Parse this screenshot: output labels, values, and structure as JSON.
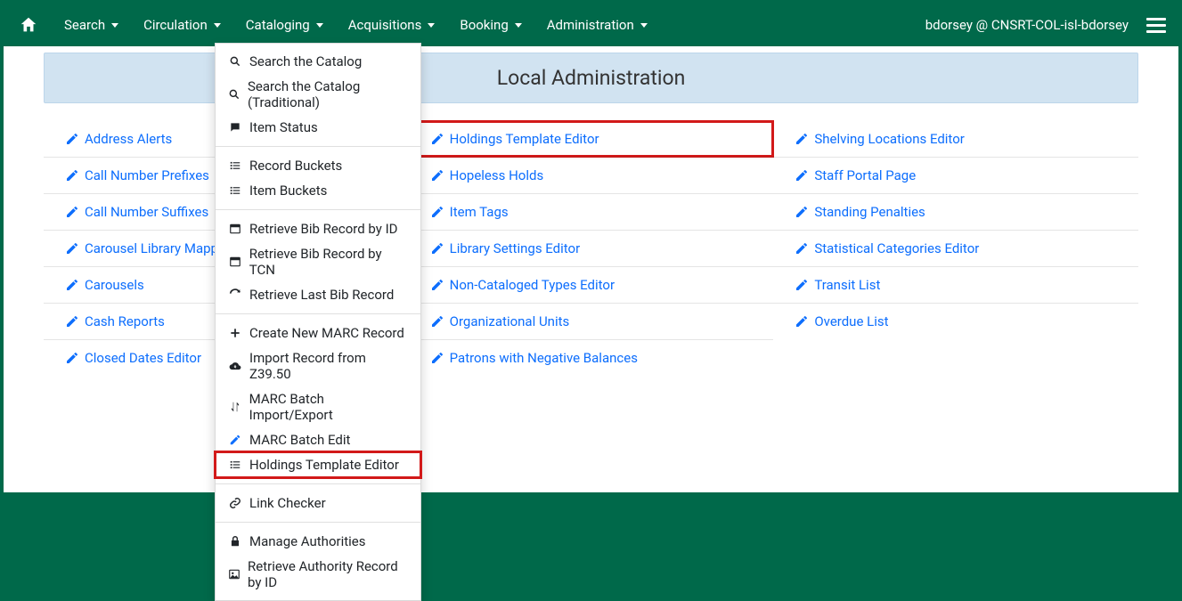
{
  "nav": {
    "items": [
      "Search",
      "Circulation",
      "Cataloging",
      "Acquisitions",
      "Booking",
      "Administration"
    ],
    "user": "bdorsey @ CNSRT-COL-isl-bdorsey"
  },
  "page_title": "Local Administration",
  "columns": [
    [
      "Address Alerts",
      "Call Number Prefixes",
      "Call Number Suffixes",
      "Carousel Library Mapping",
      "Carousels",
      "Cash Reports",
      "Closed Dates Editor"
    ],
    [
      "Holdings Template Editor",
      "Hopeless Holds",
      "Item Tags",
      "Library Settings Editor",
      "Non-Cataloged Types Editor",
      "Organizational Units",
      "Patrons with Negative Balances"
    ],
    [
      "Shelving Locations Editor",
      "Staff Portal Page",
      "Standing Penalties",
      "Statistical Categories Editor",
      "Transit List",
      "Overdue List"
    ]
  ],
  "dropdown": {
    "groups": [
      [
        {
          "icon": "search",
          "label": "Search the Catalog"
        },
        {
          "icon": "search",
          "label": "Search the Catalog (Traditional)"
        },
        {
          "icon": "chat",
          "label": "Item Status"
        }
      ],
      [
        {
          "icon": "list",
          "label": "Record Buckets"
        },
        {
          "icon": "list",
          "label": "Item Buckets"
        }
      ],
      [
        {
          "icon": "window",
          "label": "Retrieve Bib Record by ID"
        },
        {
          "icon": "window",
          "label": "Retrieve Bib Record by TCN"
        },
        {
          "icon": "redo",
          "label": "Retrieve Last Bib Record"
        }
      ],
      [
        {
          "icon": "plus",
          "label": "Create New MARC Record"
        },
        {
          "icon": "cloud-down",
          "label": "Import Record from Z39.50"
        },
        {
          "icon": "exchange",
          "label": "MARC Batch Import/Export"
        },
        {
          "icon": "pencil",
          "label": "MARC Batch Edit"
        },
        {
          "icon": "list",
          "label": "Holdings Template Editor",
          "highlight": true
        }
      ],
      [
        {
          "icon": "link",
          "label": "Link Checker"
        }
      ],
      [
        {
          "icon": "lock",
          "label": "Manage Authorities"
        },
        {
          "icon": "image",
          "label": "Retrieve Authority Record by ID"
        }
      ]
    ]
  }
}
